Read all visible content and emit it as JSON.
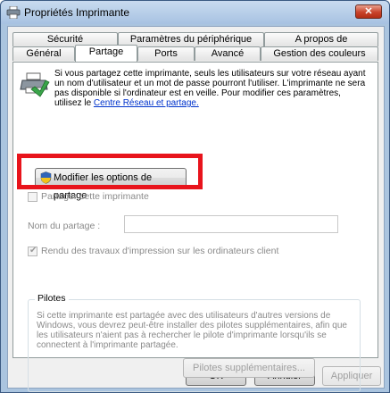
{
  "window": {
    "title": "Propriétés Imprimante",
    "close_label": "✕"
  },
  "tabs_row1": [
    {
      "label": "Sécurité"
    },
    {
      "label": "Paramètres du périphérique"
    },
    {
      "label": "A propos de"
    }
  ],
  "tabs_row2": [
    {
      "label": "Général"
    },
    {
      "label": "Partage",
      "active": true
    },
    {
      "label": "Ports"
    },
    {
      "label": "Avancé"
    },
    {
      "label": "Gestion des couleurs"
    }
  ],
  "sharing": {
    "info_text": "Si vous partagez cette imprimante, seuls les utilisateurs sur votre réseau ayant un nom d'utilisateur et un mot de passe pourront l'utiliser. L'imprimante ne sera pas disponible si l'ordinateur est en veille. Pour modifier ces paramètres, utilisez le ",
    "info_link": "Centre Réseau et partage.",
    "modify_button": "Modifier les options de partage",
    "share_checkbox_label": "Partager cette imprimante",
    "share_checked": false,
    "share_name_label": "Nom du partage :",
    "share_name_value": "",
    "render_checkbox_label": "Rendu des travaux d'impression sur les ordinateurs client",
    "render_checked": true
  },
  "drivers": {
    "title": "Pilotes",
    "text": "Si cette imprimante est partagée avec des utilisateurs d'autres versions de Windows, vous devrez peut-être installer des pilotes supplémentaires, afin que les utilisateurs n'aient pas à rechercher le pilote d'imprimante lorsqu'ils se connectent à l'imprimante partagée.",
    "button": "Pilotes supplémentaires..."
  },
  "footer": {
    "ok": "OK",
    "cancel": "Annuler",
    "apply": "Appliquer"
  },
  "icons": {
    "window": "printer-icon",
    "share": "printer-share-icon",
    "shield": "uac-shield-icon"
  },
  "colors": {
    "highlight": "#e8141c",
    "link": "#0033cc",
    "close": "#c9432a"
  }
}
